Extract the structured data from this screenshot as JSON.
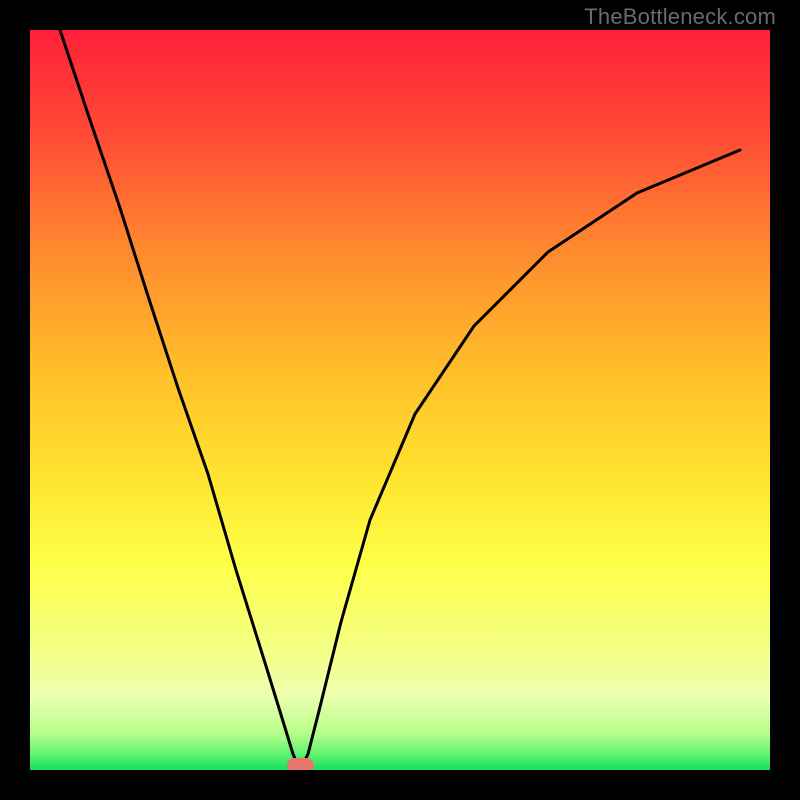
{
  "watermark": "TheBottleneck.com",
  "chart_data": {
    "type": "line",
    "title": "",
    "xlabel": "",
    "ylabel": "",
    "xlim": [
      0,
      100
    ],
    "ylim": [
      0,
      100
    ],
    "grid": false,
    "legend": false,
    "background_gradient": [
      "#ff1f3a",
      "#ff5136",
      "#ff9a2c",
      "#ffd028",
      "#ffee3a",
      "#f7ff72",
      "#9dff72",
      "#19e65e"
    ],
    "series": [
      {
        "name": "bottleneck-curve",
        "color": "#000000",
        "x": [
          4,
          8,
          12,
          16,
          20,
          24,
          28,
          32,
          34,
          35.5,
          36.5,
          37.5,
          39,
          42,
          46,
          52,
          60,
          70,
          82,
          96
        ],
        "y": [
          100,
          88,
          76,
          64,
          52,
          40,
          27,
          14,
          7,
          2,
          0,
          2,
          8,
          20,
          34,
          48,
          60,
          70,
          78,
          84
        ]
      }
    ],
    "marker": {
      "name": "optimum-marker",
      "x": 36.5,
      "y": 0,
      "color": "#e8756b",
      "width_pct": 3.5,
      "height_pct": 1.8
    }
  }
}
